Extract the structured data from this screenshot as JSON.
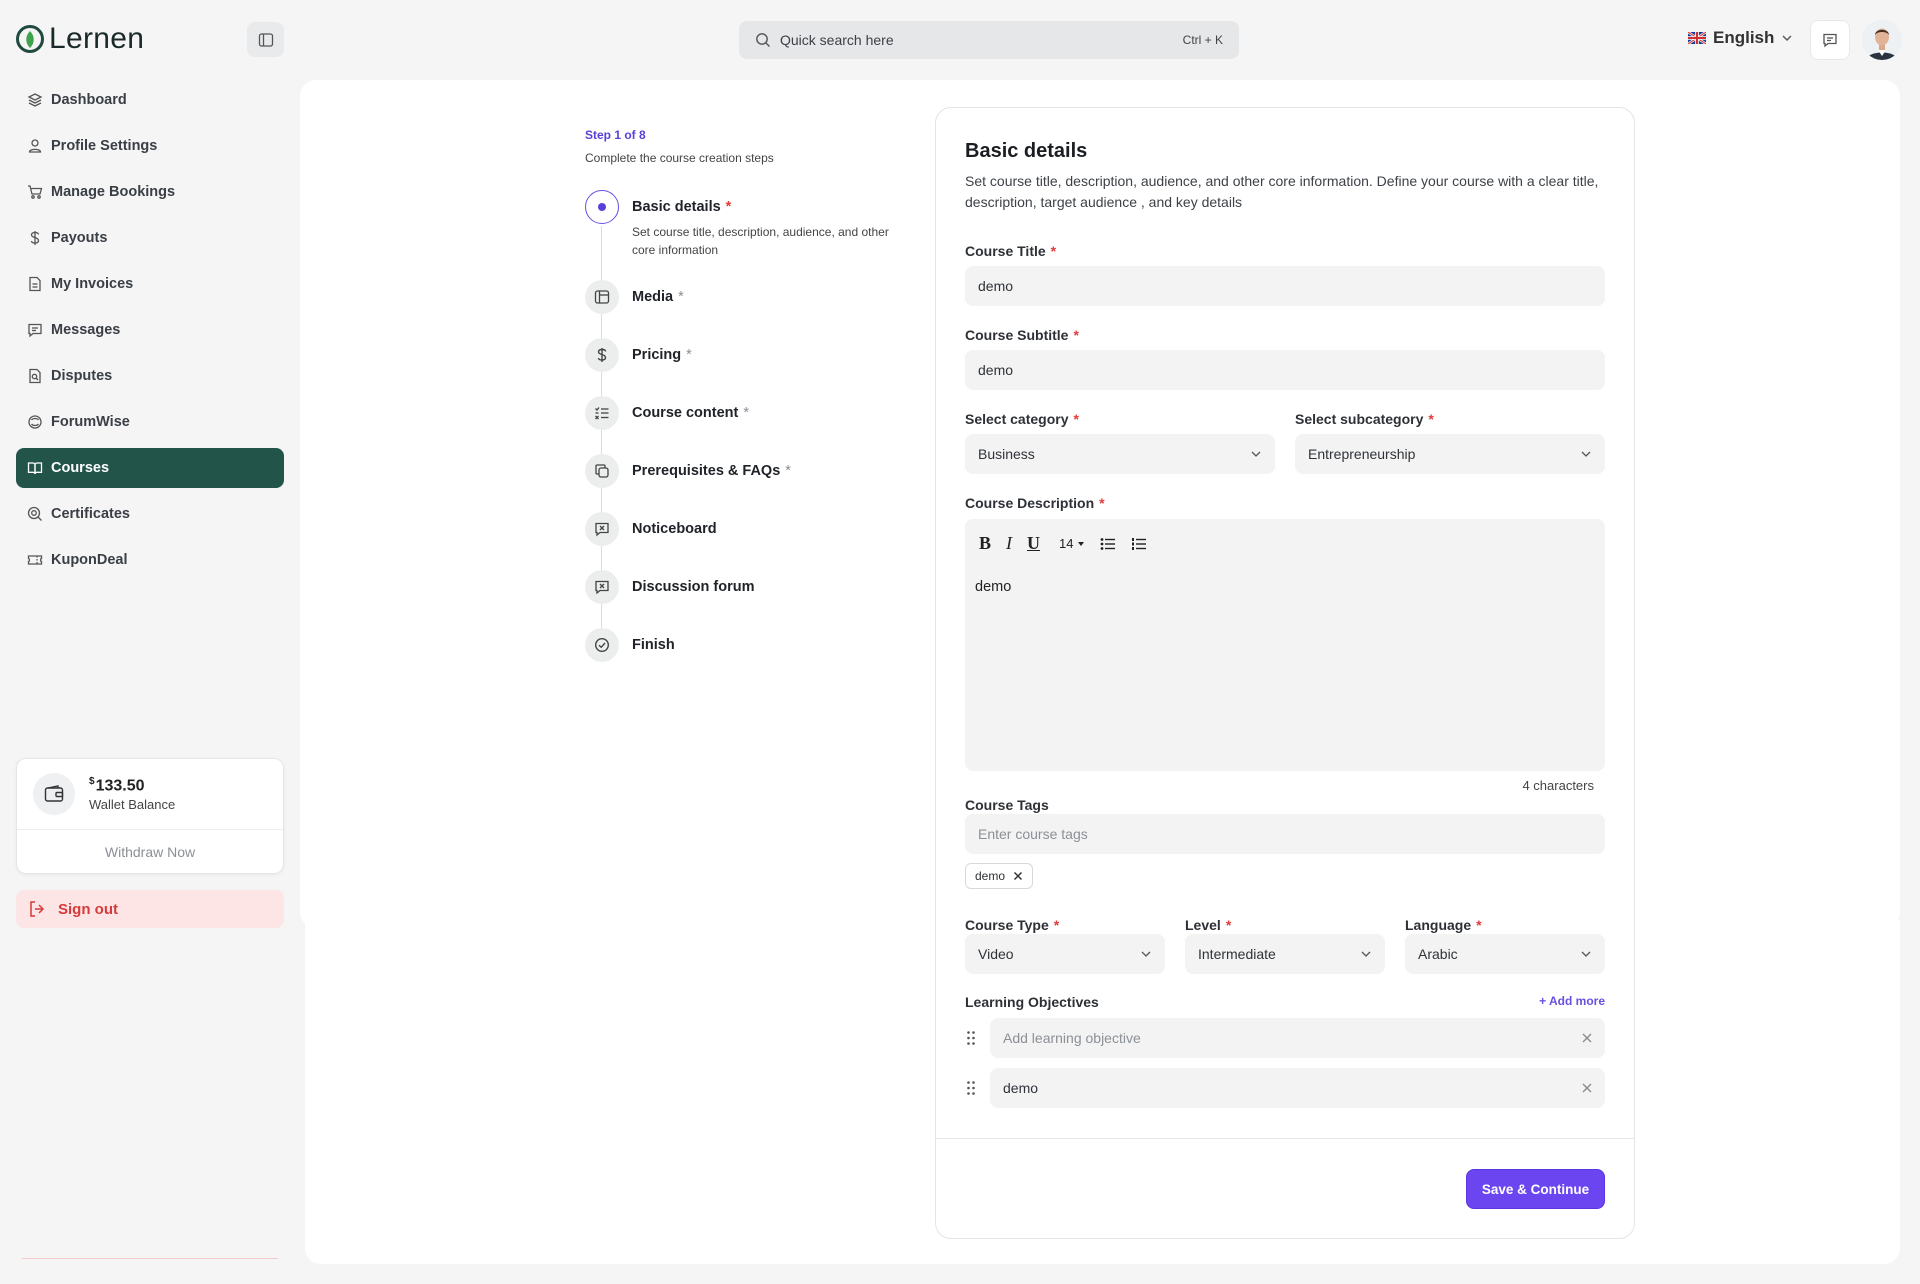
{
  "app": {
    "name": "Lernen"
  },
  "sidebar": {
    "items": [
      {
        "label": "Dashboard",
        "icon": "layers-icon"
      },
      {
        "label": "Profile Settings",
        "icon": "user-icon"
      },
      {
        "label": "Manage Bookings",
        "icon": "cart-icon"
      },
      {
        "label": "Payouts",
        "icon": "dollar-icon"
      },
      {
        "label": "My Invoices",
        "icon": "invoice-icon"
      },
      {
        "label": "Messages",
        "icon": "message-icon"
      },
      {
        "label": "Disputes",
        "icon": "dispute-icon"
      },
      {
        "label": "ForumWise",
        "icon": "forum-icon"
      },
      {
        "label": "Courses",
        "icon": "book-icon",
        "active": true
      },
      {
        "label": "Certificates",
        "icon": "certificate-icon"
      },
      {
        "label": "KuponDeal",
        "icon": "ticket-icon"
      }
    ],
    "wallet": {
      "currency": "$",
      "amount": "133.50",
      "label": "Wallet Balance",
      "withdraw": "Withdraw Now"
    },
    "signout": "Sign out"
  },
  "header": {
    "search_placeholder": "Quick search here",
    "search_shortcut": "Ctrl + K",
    "language": "English"
  },
  "stepper": {
    "step_of": "Step 1 of 8",
    "subtitle": "Complete the course creation steps",
    "steps": [
      {
        "title": "Basic details",
        "required": "*",
        "desc": "Set course title, description, audience, and other core information"
      },
      {
        "title": "Media",
        "required": "*"
      },
      {
        "title": "Pricing",
        "required": "*"
      },
      {
        "title": "Course content",
        "required": "*"
      },
      {
        "title": "Prerequisites & FAQs",
        "required": "*"
      },
      {
        "title": "Noticeboard"
      },
      {
        "title": "Discussion forum"
      },
      {
        "title": "Finish"
      }
    ]
  },
  "form": {
    "title": "Basic details",
    "description": "Set course title, description, audience, and other core information. Define your course with a clear title, description, target audience , and key details",
    "course_title": {
      "label": "Course Title",
      "value": "demo"
    },
    "course_subtitle": {
      "label": "Course Subtitle",
      "value": "demo"
    },
    "category": {
      "label": "Select category",
      "value": "Business"
    },
    "subcategory": {
      "label": "Select subcategory",
      "value": "Entrepreneurship"
    },
    "description_field": {
      "label": "Course Description",
      "font_size": "14",
      "value": "demo",
      "char_count": "4 characters"
    },
    "tags": {
      "label": "Course Tags",
      "placeholder": "Enter course tags",
      "chips": [
        "demo"
      ]
    },
    "course_type": {
      "label": "Course Type",
      "value": "Video"
    },
    "level": {
      "label": "Level",
      "value": "Intermediate"
    },
    "language": {
      "label": "Language",
      "value": "Arabic"
    },
    "objectives": {
      "label": "Learning Objectives",
      "add_more": "+ Add more",
      "placeholder": "Add learning objective",
      "items": [
        "demo"
      ]
    },
    "required_mark": "*",
    "submit": "Save & Continue"
  },
  "colors": {
    "accent": "#6b45f0",
    "sidebar_active": "#225449",
    "required": "#e23b3b"
  }
}
